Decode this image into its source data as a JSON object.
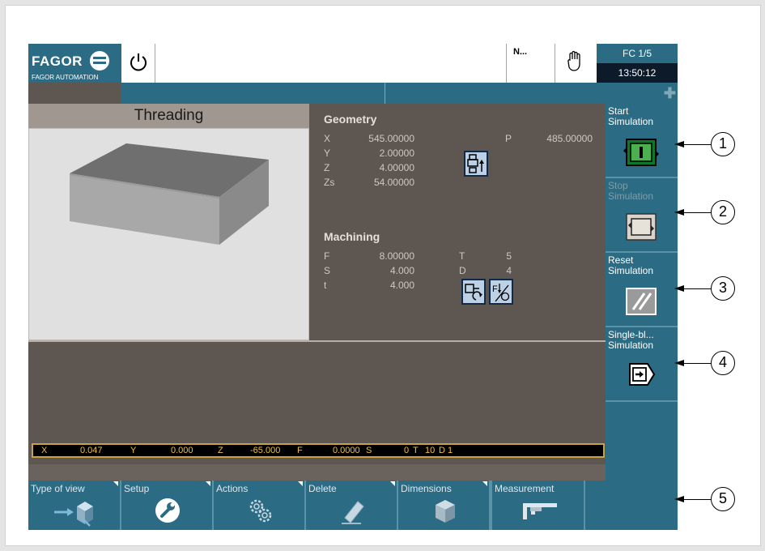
{
  "header": {
    "brand": "FAGOR",
    "brand_sub": "FAGOR AUTOMATION",
    "program_indicator": "N...",
    "channel": "FC 1/5",
    "time": "13:50:12"
  },
  "view": {
    "title": "Threading"
  },
  "geometry": {
    "title": "Geometry",
    "rows": [
      {
        "label": "X",
        "value": "545.00000"
      },
      {
        "label": "Y",
        "value": "2.00000"
      },
      {
        "label": "Z",
        "value": "4.00000"
      },
      {
        "label": "Zs",
        "value": "54.00000"
      }
    ],
    "p_label": "P",
    "p_value": "485.00000"
  },
  "machining": {
    "title": "Machining",
    "rows": [
      {
        "label": "F",
        "value": "8.00000"
      },
      {
        "label": "S",
        "value": "4.000"
      },
      {
        "label": "t",
        "value": "4.000"
      }
    ],
    "t_label": "T",
    "t_value": "5",
    "d_label": "D",
    "d_value": "4"
  },
  "status": {
    "x_label": "X",
    "x_value": "0.047",
    "y_label": "Y",
    "y_value": "0.000",
    "z_label": "Z",
    "z_value": "-65.000",
    "f_label": "F",
    "f_value": "0.0000",
    "s_label": "S",
    "s_value": "0",
    "t_label": "T",
    "t_value": "10",
    "d_label": "D",
    "d_value": "1"
  },
  "right_keys": [
    {
      "line1": "Start",
      "line2": "Simulation",
      "enabled": true
    },
    {
      "line1": "Stop",
      "line2": "Simulation",
      "enabled": false
    },
    {
      "line1": "Reset",
      "line2": "Simulation",
      "enabled": true
    },
    {
      "line1": "Single-bl...",
      "line2": "Simulation",
      "enabled": true
    }
  ],
  "bottom_keys": [
    {
      "label": "Type of view"
    },
    {
      "label": "Setup"
    },
    {
      "label": "Actions"
    },
    {
      "label": "Delete"
    },
    {
      "label": "Dimensions"
    },
    {
      "label": "Measurement"
    }
  ],
  "callouts": [
    "1",
    "2",
    "3",
    "4",
    "5"
  ],
  "colors": {
    "panel_blue": "#2b6b83",
    "panel_brown": "#5d5651",
    "status_yellow": "#f0c040"
  }
}
